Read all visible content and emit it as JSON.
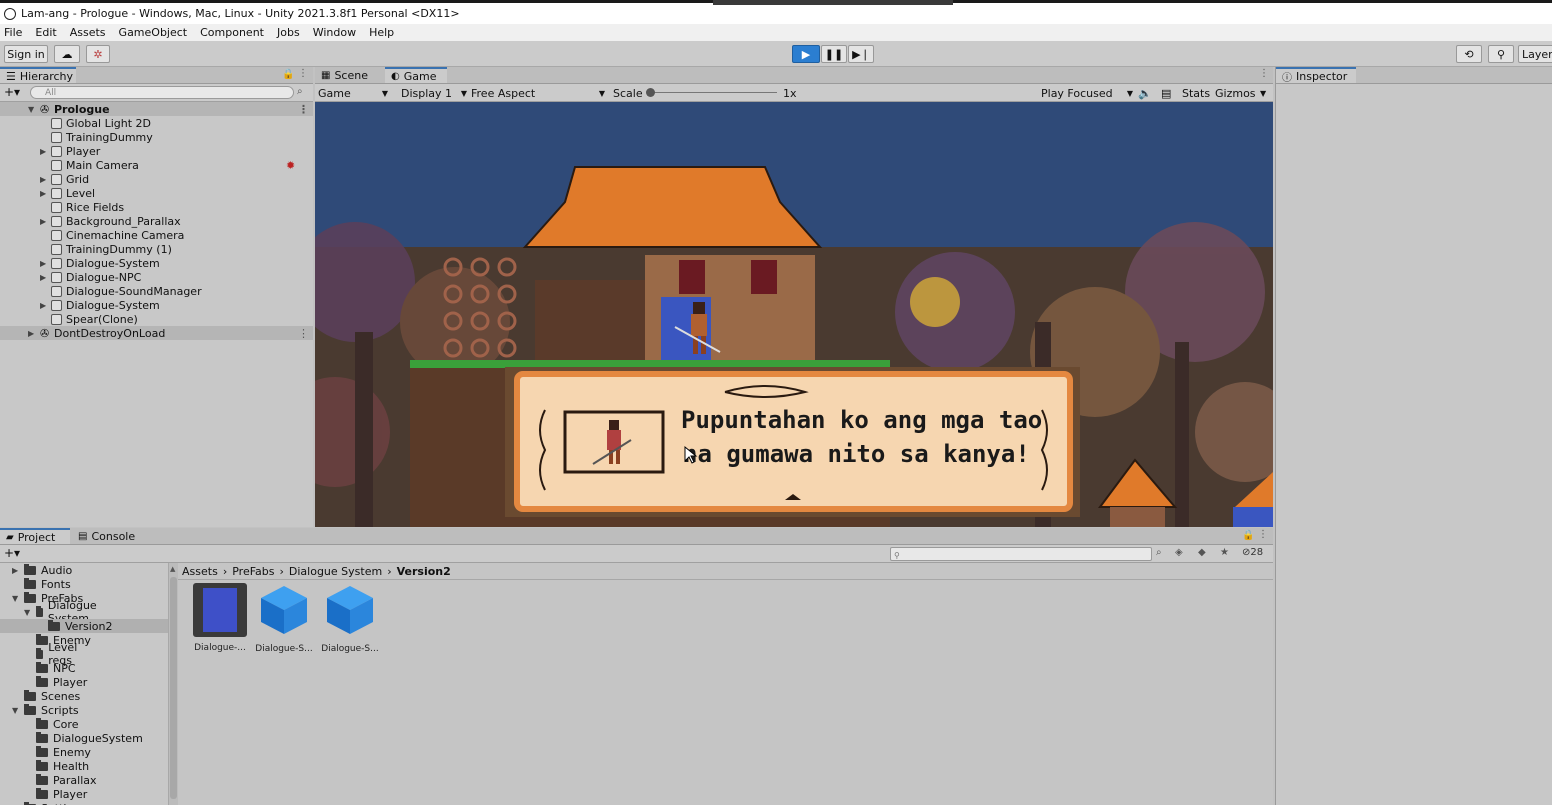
{
  "window": {
    "title": "Lam-ang - Prologue - Windows, Mac, Linux - Unity 2021.3.8f1 Personal <DX11>"
  },
  "menu": [
    "File",
    "Edit",
    "Assets",
    "GameObject",
    "Component",
    "Jobs",
    "Window",
    "Help"
  ],
  "toolbar": {
    "sign_in": "Sign in",
    "layers": "Layers"
  },
  "hierarchy": {
    "tab": "Hierarchy",
    "search_placeholder": "All",
    "scene": "Prologue",
    "items": [
      {
        "label": "Global Light 2D",
        "expandable": false
      },
      {
        "label": "TrainingDummy",
        "expandable": false
      },
      {
        "label": "Player",
        "expandable": true
      },
      {
        "label": "Main Camera",
        "expandable": false
      },
      {
        "label": "Grid",
        "expandable": true
      },
      {
        "label": "Level",
        "expandable": true
      },
      {
        "label": "Rice Fields",
        "expandable": false
      },
      {
        "label": "Background_Parallax",
        "expandable": true
      },
      {
        "label": "Cinemachine Camera",
        "expandable": false
      },
      {
        "label": "TrainingDummy (1)",
        "expandable": false
      },
      {
        "label": "Dialogue-System",
        "expandable": true
      },
      {
        "label": "Dialogue-NPC",
        "expandable": true
      },
      {
        "label": "Dialogue-SoundManager",
        "expandable": false
      },
      {
        "label": "Dialogue-System",
        "expandable": true
      },
      {
        "label": "Spear(Clone)",
        "expandable": false
      }
    ],
    "dont_destroy": "DontDestroyOnLoad"
  },
  "game": {
    "tabs": [
      "Scene",
      "Game"
    ],
    "mode": "Game",
    "display": "Display 1",
    "aspect": "Free Aspect",
    "scale_label": "Scale",
    "scale_value": "1x",
    "play_focused": "Play Focused",
    "stats": "Stats",
    "gizmos": "Gizmos",
    "dialogue_line1": "Pupuntahan ko ang mga tao",
    "dialogue_line2": "na gumawa nito sa kanya!"
  },
  "inspector": {
    "tab": "Inspector"
  },
  "project": {
    "tabs": [
      "Project",
      "Console"
    ],
    "count": "28",
    "breadcrumb": [
      "Assets",
      "PreFabs",
      "Dialogue System",
      "Version2"
    ],
    "tree": [
      {
        "label": "Audio",
        "depth": 1,
        "arrow": "▶"
      },
      {
        "label": "Fonts",
        "depth": 1,
        "arrow": ""
      },
      {
        "label": "PreFabs",
        "depth": 1,
        "arrow": "▼"
      },
      {
        "label": "Dialogue System",
        "depth": 2,
        "arrow": "▼"
      },
      {
        "label": "Version2",
        "depth": 3,
        "arrow": "",
        "selected": true
      },
      {
        "label": "Enemy",
        "depth": 2,
        "arrow": ""
      },
      {
        "label": "Level reqs",
        "depth": 2,
        "arrow": ""
      },
      {
        "label": "NPC",
        "depth": 2,
        "arrow": ""
      },
      {
        "label": "Player",
        "depth": 2,
        "arrow": ""
      },
      {
        "label": "Scenes",
        "depth": 1,
        "arrow": ""
      },
      {
        "label": "Scripts",
        "depth": 1,
        "arrow": "▼"
      },
      {
        "label": "Core",
        "depth": 2,
        "arrow": ""
      },
      {
        "label": "DialogueSystem",
        "depth": 2,
        "arrow": ""
      },
      {
        "label": "Enemy",
        "depth": 2,
        "arrow": ""
      },
      {
        "label": "Health",
        "depth": 2,
        "arrow": ""
      },
      {
        "label": "Parallax",
        "depth": 2,
        "arrow": ""
      },
      {
        "label": "Player",
        "depth": 2,
        "arrow": ""
      },
      {
        "label": "Settings",
        "depth": 1,
        "arrow": "▶"
      }
    ],
    "assets": [
      "Dialogue-...",
      "Dialogue-S...",
      "Dialogue-S..."
    ]
  },
  "colors": {
    "play_active": "#2b7ed1",
    "sky": "#2f4a78",
    "roof": "#e07a2a",
    "dialogue_bg": "#f6d6b0"
  }
}
